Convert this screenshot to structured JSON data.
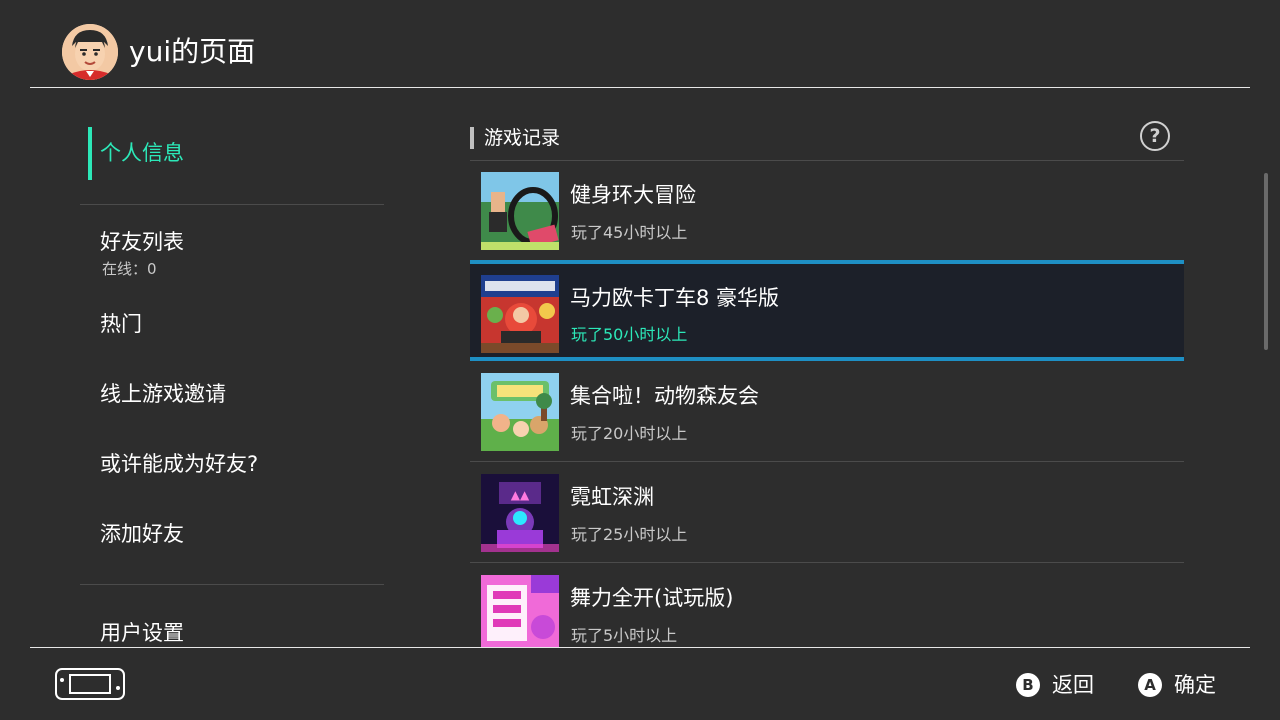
{
  "header": {
    "title": "yui的页面",
    "avatar_icon": "mii-avatar"
  },
  "sidebar": {
    "items": [
      {
        "label": "个人信息",
        "active": true
      },
      {
        "label": "好友列表",
        "sub": "在线：0"
      },
      {
        "label": "热门"
      },
      {
        "label": "线上游戏邀请"
      },
      {
        "label": "或许能成为好友?"
      },
      {
        "label": "添加好友"
      },
      {
        "label": "用户设置"
      }
    ]
  },
  "main": {
    "section_title": "游戏记录",
    "help_icon": "?",
    "games": [
      {
        "title": "健身环大冒险",
        "playtime": "玩了45小时以上"
      },
      {
        "title": "马力欧卡丁车8 豪华版",
        "playtime": "玩了50小时以上",
        "selected": true
      },
      {
        "title": "集合啦！动物森友会",
        "playtime": "玩了20小时以上"
      },
      {
        "title": "霓虹深渊",
        "playtime": "玩了25小时以上"
      },
      {
        "title": "舞力全开(试玩版)",
        "playtime": "玩了5小时以上"
      }
    ]
  },
  "footer": {
    "back_key": "B",
    "back_label": "返回",
    "ok_key": "A",
    "ok_label": "确定"
  },
  "colors": {
    "background": "#2d2d2d",
    "accent": "#2ce8b8",
    "selection_border": "#1e8fc4"
  }
}
